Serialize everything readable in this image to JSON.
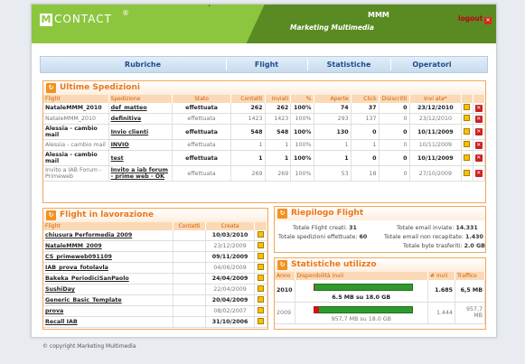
{
  "header": {
    "brand": "CONTACT",
    "brand_letter": "M",
    "brand_star": "®",
    "mmm": "MMM",
    "subtitle": "Marketing Multimedia",
    "logout": "logout"
  },
  "nav": [
    "Rubriche",
    "Flight",
    "Statistiche",
    "Operatori"
  ],
  "ultime": {
    "title": "Ultime Spedizioni",
    "columns": [
      "Flight",
      "Spedizione",
      "Stato",
      "Contatti",
      "Inviati",
      "%",
      "Aperte",
      "Click",
      "Disiscritti",
      "Invi ata*"
    ],
    "rows": [
      {
        "flight": "NataleMMM_2010",
        "sped": "def_matteo",
        "stato": "effettuata",
        "contatti": "262",
        "inviati": "262",
        "pct": "100%",
        "aperte": "74",
        "click": "37",
        "disiscritti": "0",
        "inviata": "23/12/2010",
        "style": "bold"
      },
      {
        "flight": "NataleMMM_2010",
        "sped": "definitiva",
        "stato": "effettuata",
        "contatti": "1423",
        "inviati": "1423",
        "pct": "100%",
        "aperte": "293",
        "click": "137",
        "disiscritti": "0",
        "inviata": "23/12/2010",
        "style": "dim"
      },
      {
        "flight": "Alessia - cambio mail",
        "sped": "Invio clienti",
        "stato": "effettuata",
        "contatti": "548",
        "inviati": "548",
        "pct": "100%",
        "aperte": "130",
        "click": "0",
        "disiscritti": "0",
        "inviata": "10/11/2009",
        "style": "bold"
      },
      {
        "flight": "Alessia - cambio mail",
        "sped": "INVIO",
        "stato": "effettuata",
        "contatti": "1",
        "inviati": "1",
        "pct": "100%",
        "aperte": "1",
        "click": "1",
        "disiscritti": "0",
        "inviata": "10/11/2009",
        "style": "dim"
      },
      {
        "flight": "Alessia - cambio mail",
        "sped": "test",
        "stato": "effettuata",
        "contatti": "1",
        "inviati": "1",
        "pct": "100%",
        "aperte": "1",
        "click": "0",
        "disiscritti": "0",
        "inviata": "10/11/2009",
        "style": "bold"
      },
      {
        "flight": "Invito a IAB Forum - Primeweb",
        "sped": "Invito a iab forum - prime web - OK",
        "stato": "effettuata",
        "contatti": "269",
        "inviati": "269",
        "pct": "100%",
        "aperte": "53",
        "click": "18",
        "disiscritti": "0",
        "inviata": "27/10/2009",
        "style": "dim"
      }
    ]
  },
  "lavorazione": {
    "title": "Flight in lavorazione",
    "columns": [
      "Flight",
      "Contatti",
      "Creata"
    ],
    "rows": [
      {
        "flight": "chiusura Performedia 2009",
        "contatti": "",
        "creata": "10/03/2010",
        "style": "bold"
      },
      {
        "flight": "NataleMMM_2009",
        "contatti": "",
        "creata": "23/12/2009",
        "style": "dim"
      },
      {
        "flight": "CS_primeweb091109",
        "contatti": "",
        "creata": "09/11/2009",
        "style": "bold"
      },
      {
        "flight": "IAB_prova_fotolavla",
        "contatti": "",
        "creata": "04/06/2009",
        "style": "dim"
      },
      {
        "flight": "Bakeka_PeriodiciSanPaolo",
        "contatti": "",
        "creata": "24/04/2009",
        "style": "bold"
      },
      {
        "flight": "SushiDay",
        "contatti": "",
        "creata": "22/04/2009",
        "style": "dim"
      },
      {
        "flight": "Generic_Basic_Template",
        "contatti": "",
        "creata": "20/04/2009",
        "style": "bold"
      },
      {
        "flight": "prova",
        "contatti": "",
        "creata": "08/02/2007",
        "style": "dim"
      },
      {
        "flight": "Recall IAB",
        "contatti": "",
        "creata": "31/10/2006",
        "style": "bold"
      }
    ]
  },
  "riepilogo": {
    "title": "Riepilogo Flight",
    "creati_label": "Totale Flight creati:",
    "creati_value": "31",
    "email_inviate_label": "Totale email inviate:",
    "email_inviate_value": "14.331",
    "spedizioni_label": "Totale spedizioni effettuate:",
    "spedizioni_value": "60",
    "non_recapitate_label": "Totale email non recapitate:",
    "non_recapitate_value": "1.430",
    "byte_label": "Totale byte trasferiti:",
    "byte_value": "2.0 GB"
  },
  "statistiche": {
    "title": "Statistiche utilizzo",
    "columns": [
      "Anno",
      "Disponibilità invii",
      "# Invii",
      "Traffico"
    ],
    "rows": [
      {
        "anno": "2010",
        "disp": "6.5 MB su 18.0 GB",
        "invii": "1.685",
        "traffico": "6,5 MB",
        "used_fraction": 0.0004,
        "style": "bold"
      },
      {
        "anno": "2009",
        "disp": "957,7 MB su 18.0 GB",
        "invii": "1.444",
        "traffico": "957,7 MB",
        "used_fraction": 0.053,
        "style": "dim"
      }
    ]
  },
  "footer": "© copyright Marketing Multimedia",
  "colors": {
    "green": "#8cc63f",
    "dark_green": "#5a8b22",
    "orange": "#e8781e",
    "nav_text": "#1d4d8c"
  }
}
